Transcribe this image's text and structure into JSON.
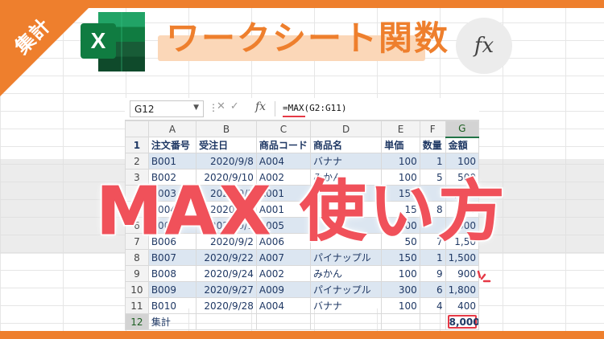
{
  "badge": {
    "label": "集計"
  },
  "title": {
    "text": "ワークシート関数"
  },
  "logo": {
    "letter": "X"
  },
  "fx_icon": {
    "text": "fx"
  },
  "headline": {
    "text": "MAX 使い方"
  },
  "formula_bar": {
    "name_box": "G12",
    "formula": "=MAX(G2:G11)",
    "fx_label": "fx",
    "cancel_icon": "✕",
    "enter_icon": "✓"
  },
  "sheet": {
    "columns": [
      "A",
      "B",
      "C",
      "D",
      "E",
      "F",
      "G"
    ],
    "row_numbers": [
      "1",
      "2",
      "3",
      "4",
      "5",
      "6",
      "7",
      "8",
      "9",
      "10",
      "11",
      "12"
    ],
    "headers": [
      "注文番号",
      "受注日",
      "商品コード",
      "商品名",
      "単価",
      "数量",
      "金額"
    ],
    "rows": [
      [
        "B001",
        "2020/9/8",
        "A004",
        "バナナ",
        "100",
        "1",
        "100"
      ],
      [
        "B002",
        "2020/9/10",
        "A002",
        "みかん",
        "100",
        "5",
        "500"
      ],
      [
        "B003",
        "2020/9/1",
        "A001",
        "",
        "150",
        "",
        "1,500"
      ],
      [
        "B004",
        "2020/9/1",
        "A001",
        "",
        "15",
        "8",
        "000"
      ],
      [
        "B005",
        "2020/9/1",
        "A005",
        "",
        ",000",
        "",
        ",000"
      ],
      [
        "B006",
        "2020/9/2",
        "A006",
        "",
        "50",
        "7",
        "1,50"
      ],
      [
        "B007",
        "2020/9/22",
        "A007",
        "パイナップル",
        "150",
        "1",
        "1,500"
      ],
      [
        "B008",
        "2020/9/24",
        "A002",
        "みかん",
        "100",
        "9",
        "900"
      ],
      [
        "B009",
        "2020/9/27",
        "A009",
        "パイナップル",
        "300",
        "6",
        "1,800"
      ],
      [
        "B010",
        "2020/9/28",
        "A004",
        "バナナ",
        "100",
        "4",
        "400"
      ]
    ],
    "total_label": "集計",
    "total_value": "8,000"
  },
  "colors": {
    "accent": "#ee7f2d",
    "headline": "#f0515a",
    "excel_green": "#217346",
    "band_blue": "#dce6f1"
  }
}
